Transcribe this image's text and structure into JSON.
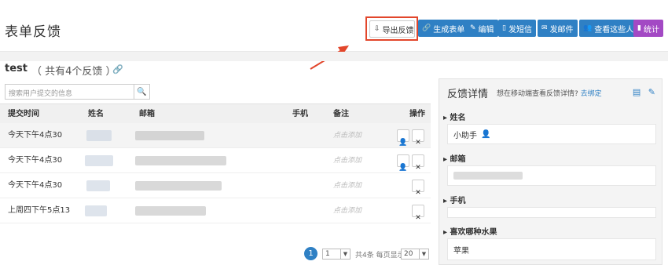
{
  "header": {
    "title": "表单反馈",
    "buttons": [
      {
        "label": "导出反馈",
        "icon": "export-icon"
      },
      {
        "label": "生成表单",
        "icon": "link-icon"
      },
      {
        "label": "编辑",
        "icon": "pencil-icon"
      },
      {
        "label": "发短信",
        "icon": "phone-icon"
      },
      {
        "label": "发邮件",
        "icon": "mail-icon"
      },
      {
        "label": "查看这些人",
        "icon": "users-icon"
      },
      {
        "label": "统计",
        "icon": "bar-chart-icon"
      }
    ]
  },
  "section": {
    "name": "test",
    "count_text": "（ 共有4个反馈 ）"
  },
  "search": {
    "placeholder": "搜索用户提交的信息"
  },
  "table": {
    "headers": [
      "提交时间",
      "姓名",
      "邮箱",
      "手机",
      "备注",
      "操作"
    ],
    "note_placeholder": "点击添加",
    "rows": [
      {
        "time": "今天下午4点30"
      },
      {
        "time": "今天下午4点30"
      },
      {
        "time": "今天下午4点30"
      },
      {
        "time": "上周四下午5点13"
      }
    ]
  },
  "pagination": {
    "current_page": "1",
    "page_select": "1",
    "summary": "共4条 每页显示",
    "per_page": "20"
  },
  "panel": {
    "title": "反馈详情",
    "subtitle": "想在移动端查看反馈详情?",
    "bind_link": "去绑定",
    "fields": [
      {
        "label": "姓名",
        "value": "小助手"
      },
      {
        "label": "邮箱",
        "value": ""
      },
      {
        "label": "手机",
        "value": ""
      },
      {
        "label": "喜欢哪种水果",
        "value": "苹果"
      }
    ]
  },
  "colors": {
    "primary": "#2f80c4",
    "stats": "#a349c4",
    "highlight": "#e2462b"
  }
}
